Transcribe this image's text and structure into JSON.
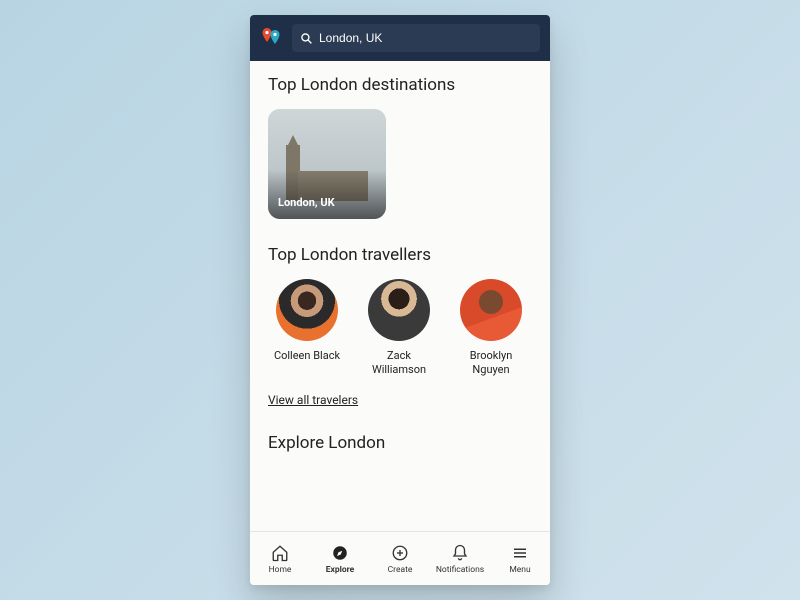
{
  "header": {
    "search_value": "London, UK"
  },
  "sections": {
    "destinations_title": "Top London destinations",
    "travellers_title": "Top London travellers",
    "explore_title": "Explore London"
  },
  "destination_card": {
    "label": "London, UK"
  },
  "travellers": [
    {
      "name": "Colleen Black"
    },
    {
      "name": "Zack Williamson"
    },
    {
      "name": "Brooklyn Nguyen"
    }
  ],
  "view_all_label": "View all travelers",
  "nav": {
    "home": "Home",
    "explore": "Explore",
    "create": "Create",
    "notifications": "Notifications",
    "menu": "Menu"
  }
}
